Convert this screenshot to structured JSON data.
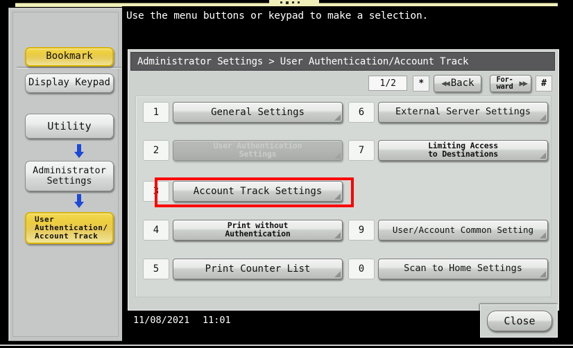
{
  "sidebar": {
    "buttons": [
      {
        "name": "bookmark",
        "label": "Bookmark",
        "style": "yellow"
      },
      {
        "name": "display-keypad",
        "label": "Display Keypad",
        "style": "grey"
      },
      {
        "name": "utility",
        "label": "Utility",
        "style": "grey"
      },
      {
        "name": "administrator-settings",
        "label": "Administrator\nSettings",
        "style": "grey"
      },
      {
        "name": "user-authentication-account-track",
        "label": "User\nAuthentication/\nAccount Track",
        "style": "yellow"
      }
    ],
    "arrow_icon": "down-arrow-icon",
    "arrow_color": "#1b49d8"
  },
  "main": {
    "instruction": "Use the menu buttons or keypad to make a selection.",
    "breadcrumb": "Administrator Settings > User Authentication/Account Track",
    "pager": {
      "page_indicator": "1/2",
      "star_key": "*",
      "back_label": "Back",
      "back_glyph": "◀◀",
      "forward_label": "For-\nward",
      "forward_glyph": "▶▶",
      "hash_key": "#"
    },
    "menu_left": [
      {
        "num": "1",
        "label": "General Settings",
        "lines": 1,
        "disabled": false,
        "highlighted": false
      },
      {
        "num": "2",
        "label": "User Authentication\nSettings",
        "lines": 2,
        "disabled": true,
        "highlighted": false
      },
      {
        "num": "3",
        "label": "Account Track Settings",
        "lines": 1,
        "disabled": false,
        "highlighted": true
      },
      {
        "num": "4",
        "label": "Print without\nAuthentication",
        "lines": 2,
        "disabled": false,
        "highlighted": false
      },
      {
        "num": "5",
        "label": "Print Counter List",
        "lines": 1,
        "disabled": false,
        "highlighted": false
      }
    ],
    "menu_right": [
      {
        "num": "6",
        "label": "External Server Settings",
        "lines": 1,
        "disabled": false,
        "highlighted": false
      },
      {
        "num": "7",
        "label": "Limiting Access\nto Destinations",
        "lines": 2,
        "disabled": false,
        "highlighted": false
      },
      {
        "num": "9",
        "label": "User/Account Common Setting",
        "lines": 1,
        "disabled": false,
        "highlighted": false
      },
      {
        "num": "0",
        "label": "Scan to Home Settings",
        "lines": 1,
        "disabled": false,
        "highlighted": false
      }
    ],
    "status": {
      "date": "11/08/2021",
      "time": "11:01",
      "close_label": "Close"
    }
  },
  "colors": {
    "highlight_red": "#fb0000",
    "bookmark_yellow": "#eccd3f",
    "arrow_blue": "#1b49d8",
    "panel_grey": "#ced2cf",
    "title_bar": "#58585a"
  }
}
